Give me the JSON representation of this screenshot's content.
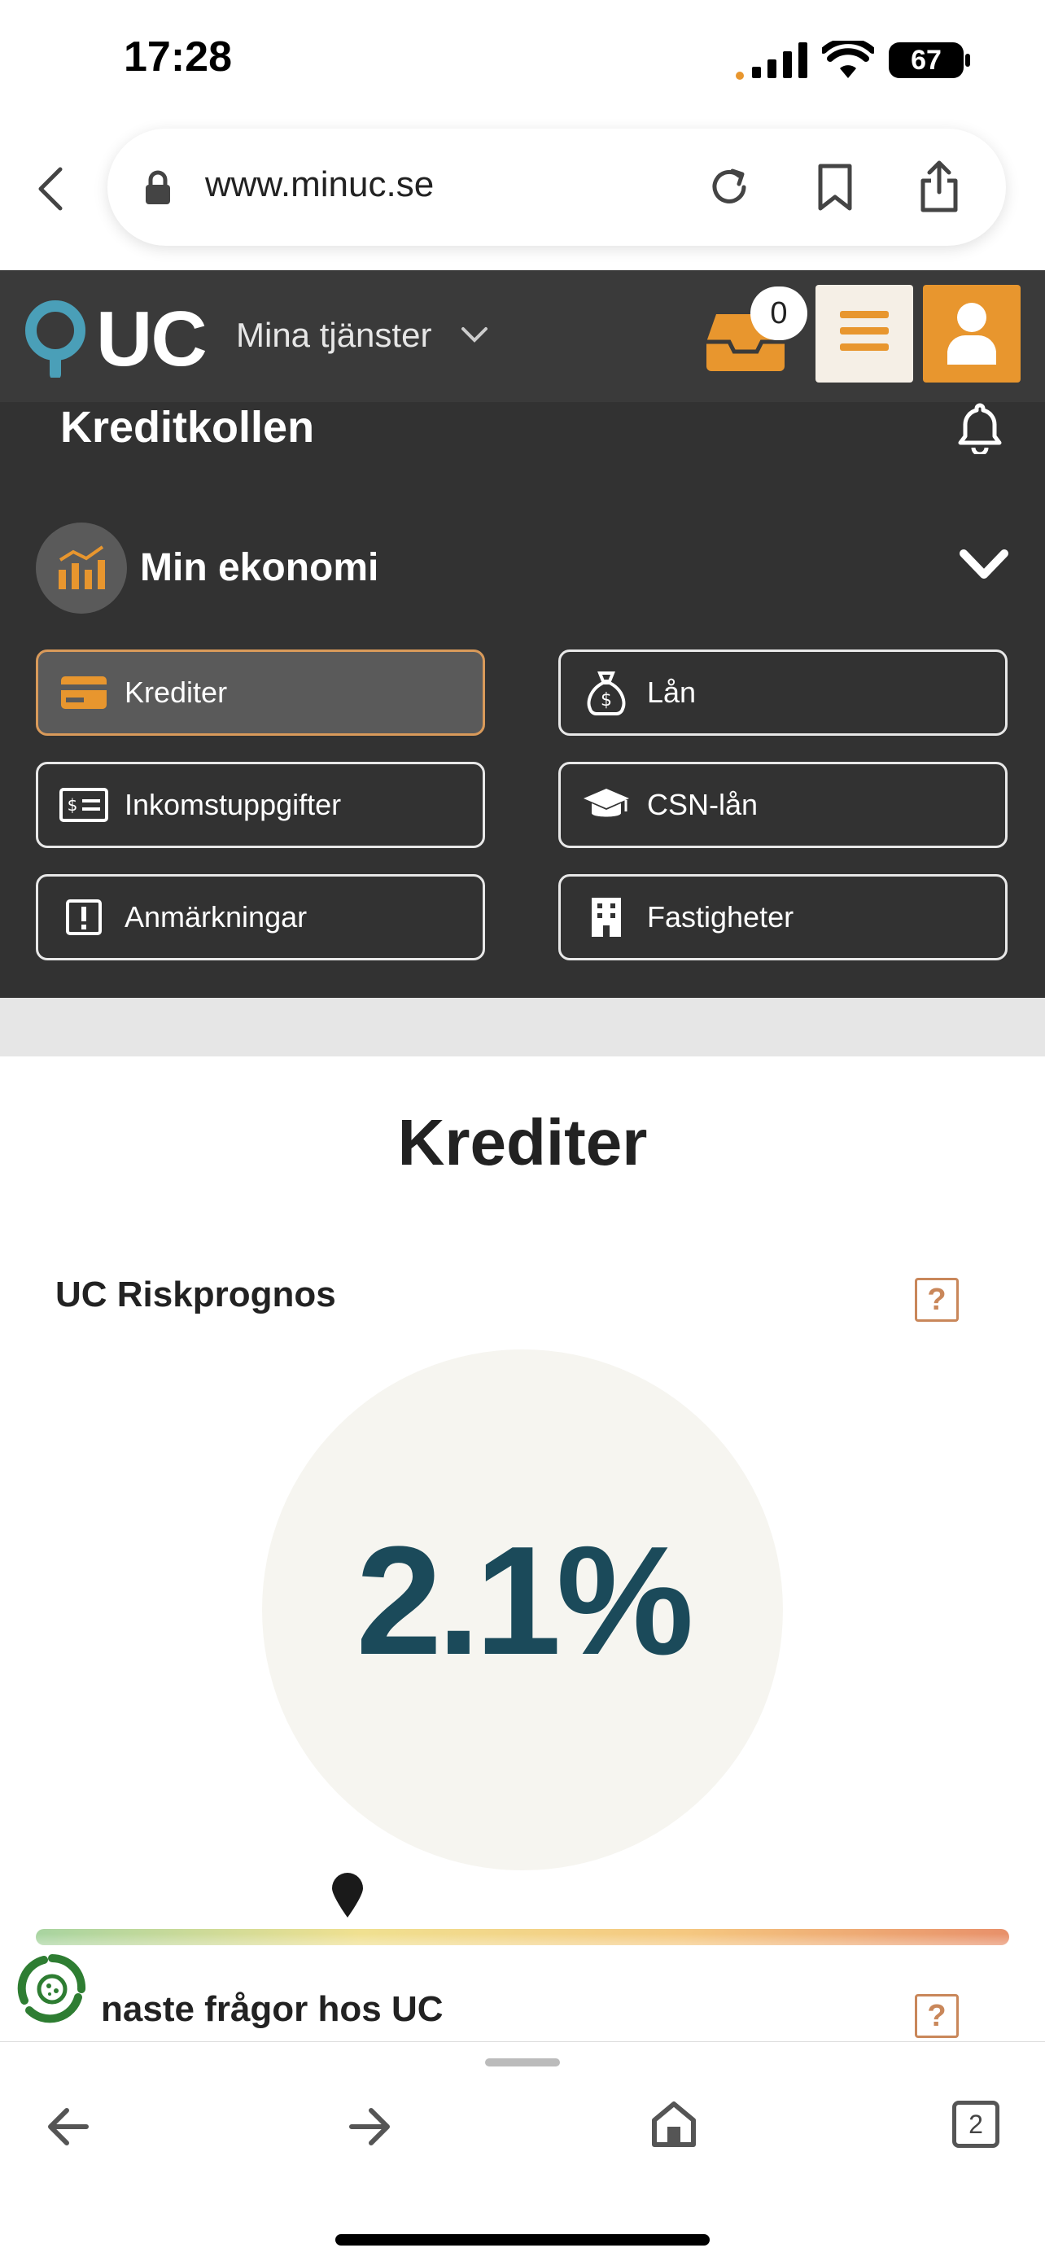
{
  "status_bar": {
    "time": "17:28",
    "battery": "67"
  },
  "browser": {
    "url": "www.minuc.se",
    "tab_count": "2"
  },
  "header": {
    "logo_text": "UC",
    "services_label": "Mina tjänster",
    "inbox_count": "0"
  },
  "panel": {
    "title": "Kreditkollen",
    "section_label": "Min ekonomi",
    "buttons": [
      {
        "label": "Krediter",
        "icon": "credit-card-icon"
      },
      {
        "label": "Lån",
        "icon": "money-bag-icon"
      },
      {
        "label": "Inkomstuppgifter",
        "icon": "income-icon"
      },
      {
        "label": "CSN-lån",
        "icon": "graduation-cap-icon"
      },
      {
        "label": "Anmärkningar",
        "icon": "exclamation-icon"
      },
      {
        "label": "Fastigheter",
        "icon": "building-icon"
      }
    ]
  },
  "main": {
    "heading": "Krediter",
    "risk_label": "UC Riskprognos",
    "risk_value": "2.1%",
    "risk_marker_position": 0.32,
    "next_section_label": "naste frågor hos UC"
  },
  "colors": {
    "accent": "#E8962E",
    "dark": "#323232",
    "risk_text": "#1B4A5A"
  }
}
